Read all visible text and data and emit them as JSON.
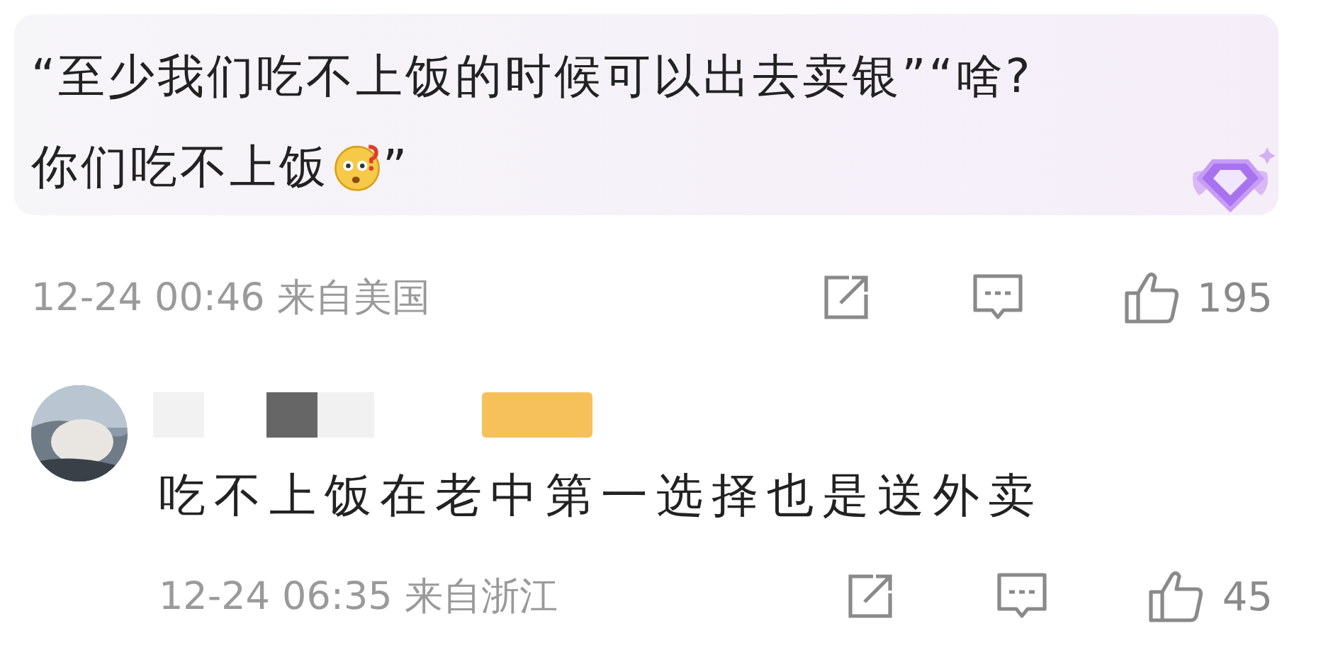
{
  "post": {
    "lines": [
      "“至少我们吃不上饭的时候可以出去卖银”“啥?",
      "你们吃不上饭"
    ],
    "closing": "”",
    "time": "12-24 00:46",
    "location": "来自美国",
    "likes": "195"
  },
  "reply": {
    "text": "吃不上饭在老中第一选择也是送外卖",
    "time": "12-24 06:35",
    "location": "来自浙江",
    "likes": "45"
  }
}
